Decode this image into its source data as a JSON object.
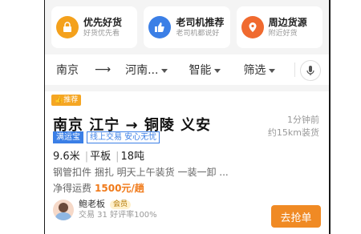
{
  "cards": [
    {
      "title": "优先好货",
      "sub": "好货优先看",
      "icon": "lock-icon",
      "color": "#f4a11c"
    },
    {
      "title": "老司机推荐",
      "sub": "老司机都说好",
      "icon": "thumbs-up-icon",
      "color": "#3b7fe6"
    },
    {
      "title": "周边货源",
      "sub": "附近好货",
      "icon": "map-pin-icon",
      "color": "#f06a2f"
    }
  ],
  "filter": {
    "from": "南京",
    "arrow": "⟶",
    "to": "河南...",
    "vehicle": "智能",
    "filter": "筛选"
  },
  "cargo": {
    "badge": "推荐",
    "route": "南京 江宁 → 铜陵 义安",
    "time_ago": "1分钟前",
    "distance": "约15km装货",
    "tags": [
      "满运宝",
      "线上交易 安心无忧"
    ],
    "specs": [
      "9.6米",
      "平板",
      "18吨"
    ],
    "description": "钢管扣件 捆扎 明天上午装货 一装一卸 ...",
    "fee_label": "净得运费",
    "fee_value": "1500元/趟",
    "owner_name": "鲍老板",
    "member_label": "会员",
    "owner_stats": "交易 31  好评率100%",
    "action_label": "去抢单"
  }
}
